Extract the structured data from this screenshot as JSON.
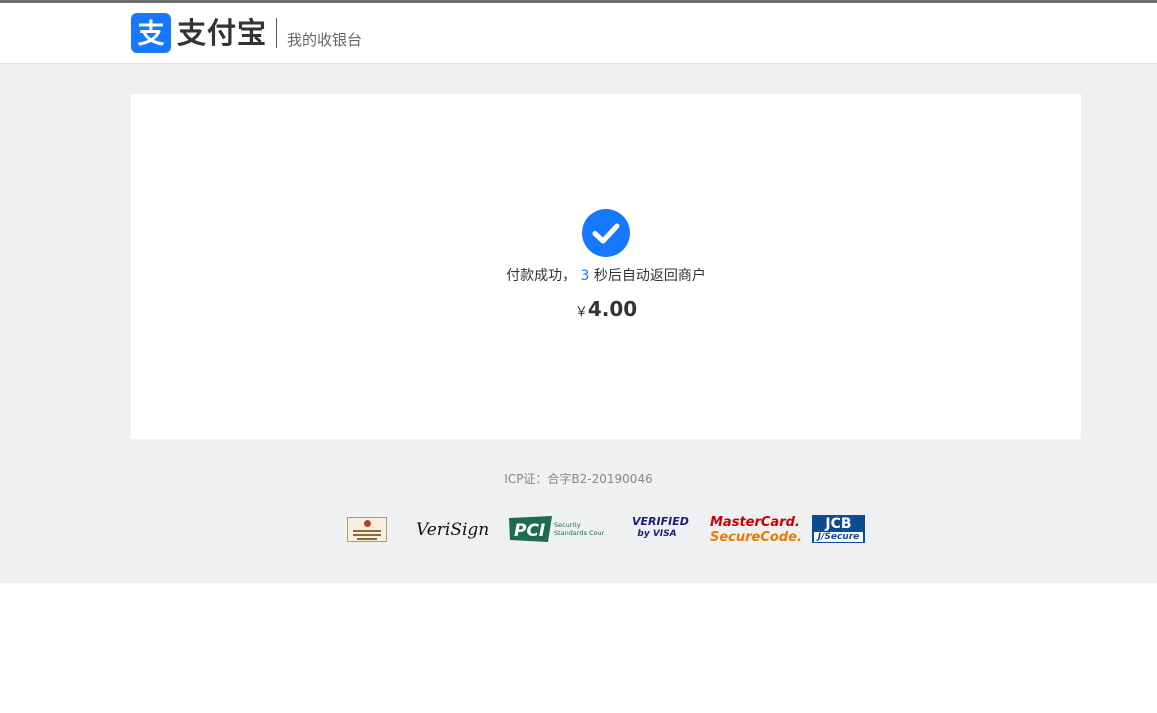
{
  "header": {
    "logo_text": "支付宝",
    "logo_glyph": "支",
    "cashier_title": "我的收银台"
  },
  "result": {
    "status_prefix": "付款成功，",
    "countdown": "3",
    "status_suffix": "秒后自动返回商户",
    "currency_symbol": "￥",
    "amount": "4.00"
  },
  "footer": {
    "icp": "ICP证：合字B2-20190046",
    "badges": {
      "verisign": "VeriSign",
      "pci_logo": "PCI",
      "pci_text_1": "Security",
      "pci_text_2": "Standards Council",
      "visa_1": "VERIFIED",
      "visa_2": "by VISA",
      "mastercard_1": "MasterCard.",
      "mastercard_2": "SecureCode.",
      "jcb_1": "JCB",
      "jcb_2": "J/Secure"
    }
  },
  "colors": {
    "brand_blue": "#1677ff",
    "background_gray": "#eff0f2",
    "text_dark": "#333333"
  },
  "icons": {
    "success": "check-circle-icon",
    "logo": "alipay-logo-icon"
  }
}
